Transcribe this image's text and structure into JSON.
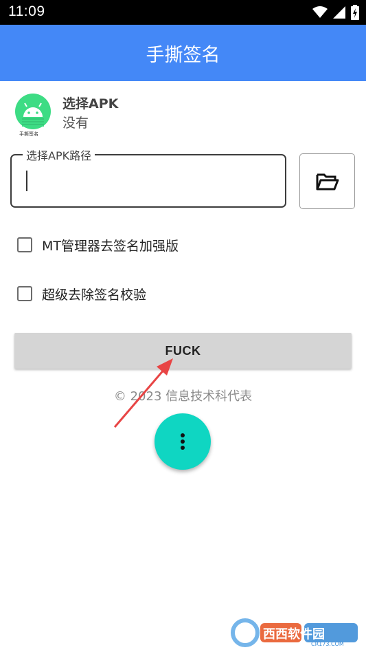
{
  "status_bar": {
    "time": "11:09"
  },
  "app_bar": {
    "title": "手撕签名"
  },
  "apk": {
    "title": "选择APK",
    "subtitle": "没有",
    "icon_caption": "手撕签名"
  },
  "path_field": {
    "label": "选择APK路径",
    "value": ""
  },
  "options": [
    {
      "label": "MT管理器去签名加强版",
      "checked": false
    },
    {
      "label": "超级去除签名校验",
      "checked": false
    }
  ],
  "action_button": {
    "label": "FUCK"
  },
  "footer": {
    "copyright": "© 2023 信息技术科代表"
  },
  "watermark": {
    "site": "西西软件园",
    "url": "CR173.COM"
  },
  "colors": {
    "app_bar": "#4488f7",
    "fab": "#0fd6c2",
    "arrow": "#e84545",
    "android": "#3ddc84"
  }
}
